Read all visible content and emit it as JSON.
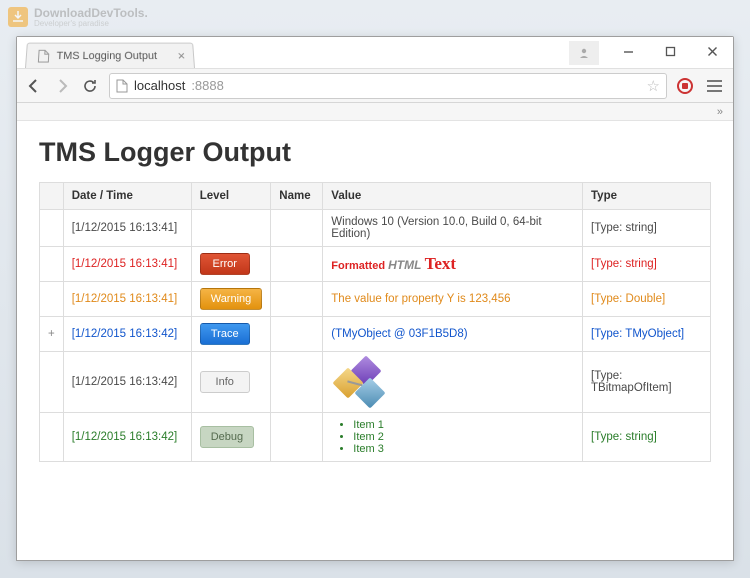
{
  "watermark": {
    "brand": "DownloadDevTools.",
    "tagline": "Developer's paradise"
  },
  "browser": {
    "tab_title": "TMS Logging Output",
    "address_host": "localhost",
    "address_port": ":8888",
    "overflow": "»"
  },
  "page": {
    "title": "TMS Logger Output"
  },
  "table": {
    "headers": {
      "date": "Date / Time",
      "level": "Level",
      "name": "Name",
      "value": "Value",
      "type": "Type"
    },
    "rows": [
      {
        "expand": "",
        "date": "[1/12/2015 16:13:41]",
        "level": "",
        "levelClass": "none",
        "rowClass": "row-default",
        "name": "",
        "valueMode": "text",
        "value": "Windows 10 (Version 10.0, Build 0, 64-bit Edition)",
        "type": "[Type: string]"
      },
      {
        "expand": "",
        "date": "[1/12/2015 16:13:41]",
        "level": "Error",
        "levelClass": "error",
        "rowClass": "row-error",
        "name": "",
        "valueMode": "formatted",
        "f1": "Formatted",
        "f2": "HTML",
        "f3": "Text",
        "type": "[Type: string]"
      },
      {
        "expand": "",
        "date": "[1/12/2015 16:13:41]",
        "level": "Warning",
        "levelClass": "warning",
        "rowClass": "row-warning",
        "name": "",
        "valueMode": "text",
        "value": "The value for property Y is 123,456",
        "type": "[Type: Double]"
      },
      {
        "expand": "+",
        "date": "[1/12/2015 16:13:42]",
        "level": "Trace",
        "levelClass": "trace",
        "rowClass": "row-trace",
        "name": "",
        "valueMode": "text",
        "value": "(TMyObject @ 03F1B5D8)",
        "type": "[Type: TMyObject]"
      },
      {
        "expand": "",
        "date": "[1/12/2015 16:13:42]",
        "level": "Info",
        "levelClass": "info",
        "rowClass": "row-default",
        "name": "",
        "valueMode": "bitmap",
        "type": "[Type: TBitmapOfItem]"
      },
      {
        "expand": "",
        "date": "[1/12/2015 16:13:42]",
        "level": "Debug",
        "levelClass": "debug",
        "rowClass": "row-debug",
        "name": "",
        "valueMode": "list",
        "items": [
          "Item 1",
          "Item 2",
          "Item 3"
        ],
        "type": "[Type: string]"
      }
    ]
  }
}
